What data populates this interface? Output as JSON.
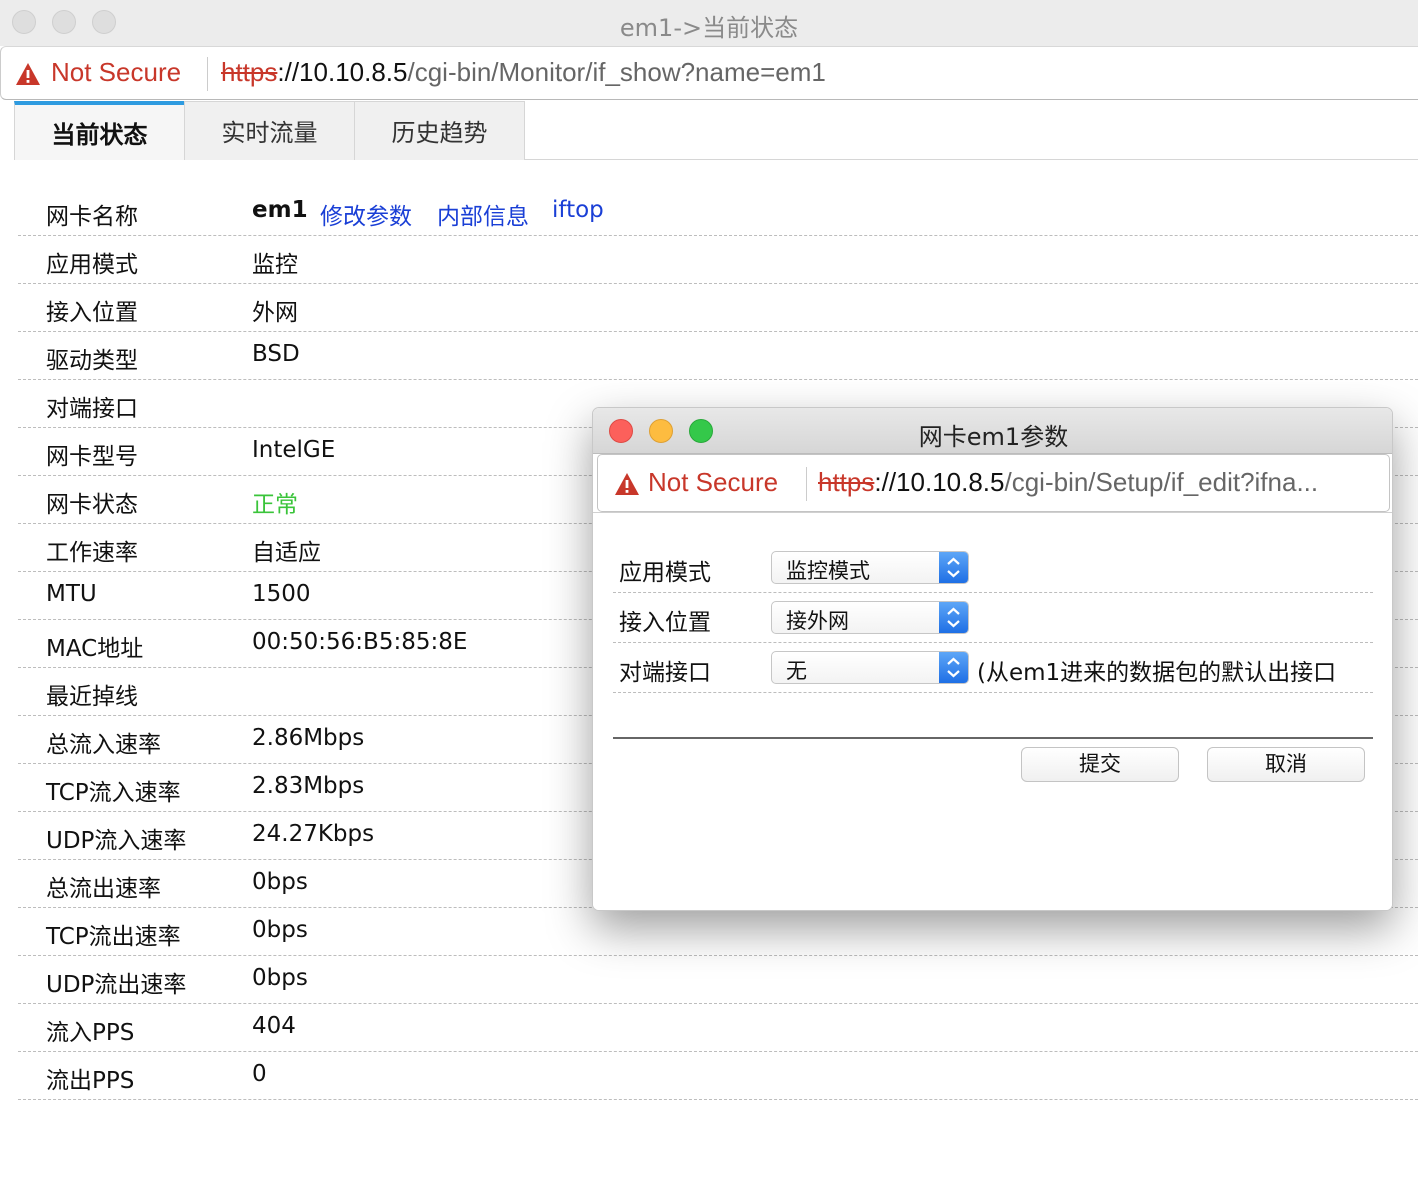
{
  "window": {
    "title": "em1->当前状态"
  },
  "address_bar": {
    "security": "Not Secure",
    "url_scheme": "https",
    "url_host": "://10.10.8.5",
    "url_path": "/cgi-bin/Monitor/if_show?name=em1"
  },
  "tabs": [
    {
      "label": "当前状态",
      "active": true
    },
    {
      "label": "实时流量",
      "active": false
    },
    {
      "label": "历史趋势",
      "active": false
    }
  ],
  "info": {
    "rows": [
      {
        "key": "网卡名称",
        "value": "em1"
      },
      {
        "key": "应用模式",
        "value": "监控"
      },
      {
        "key": "接入位置",
        "value": "外网"
      },
      {
        "key": "驱动类型",
        "value": "BSD"
      },
      {
        "key": "对端接口",
        "value": ""
      },
      {
        "key": "网卡型号",
        "value": "IntelGE"
      },
      {
        "key": "网卡状态",
        "value": "正常"
      },
      {
        "key": "工作速率",
        "value": "自适应"
      },
      {
        "key": "MTU",
        "value": "1500"
      },
      {
        "key": "MAC地址",
        "value": "00:50:56:B5:85:8E"
      },
      {
        "key": "最近掉线",
        "value": ""
      },
      {
        "key": "总流入速率",
        "value": "2.86Mbps"
      },
      {
        "key": "TCP流入速率",
        "value": "2.83Mbps"
      },
      {
        "key": "UDP流入速率",
        "value": "24.27Kbps"
      },
      {
        "key": "总流出速率",
        "value": "0bps"
      },
      {
        "key": "TCP流出速率",
        "value": "0bps"
      },
      {
        "key": "UDP流出速率",
        "value": "0bps"
      },
      {
        "key": "流入PPS",
        "value": "404"
      },
      {
        "key": "流出PPS",
        "value": "0"
      }
    ],
    "links": {
      "edit": "修改参数",
      "internal": "内部信息",
      "iftop": "iftop"
    },
    "status_color": "#3ac43a",
    "link_color": "#1a3fd6"
  },
  "popup": {
    "title": "网卡em1参数",
    "address_bar": {
      "security": "Not Secure",
      "url_scheme": "https",
      "url_host": "://10.10.8.5",
      "url_path": "/cgi-bin/Setup/if_edit?ifna..."
    },
    "fields": [
      {
        "label": "应用模式",
        "selected": "监控模式"
      },
      {
        "label": "接入位置",
        "selected": "接外网"
      },
      {
        "label": "对端接口",
        "selected": "无",
        "hint": "(从em1进来的数据包的默认出接口"
      }
    ],
    "submit_label": "提交",
    "cancel_label": "取消"
  },
  "colors": {
    "warning": "#c8372a",
    "tab_accent": "#2e9be0",
    "select_accent": "#1f6fe5"
  }
}
